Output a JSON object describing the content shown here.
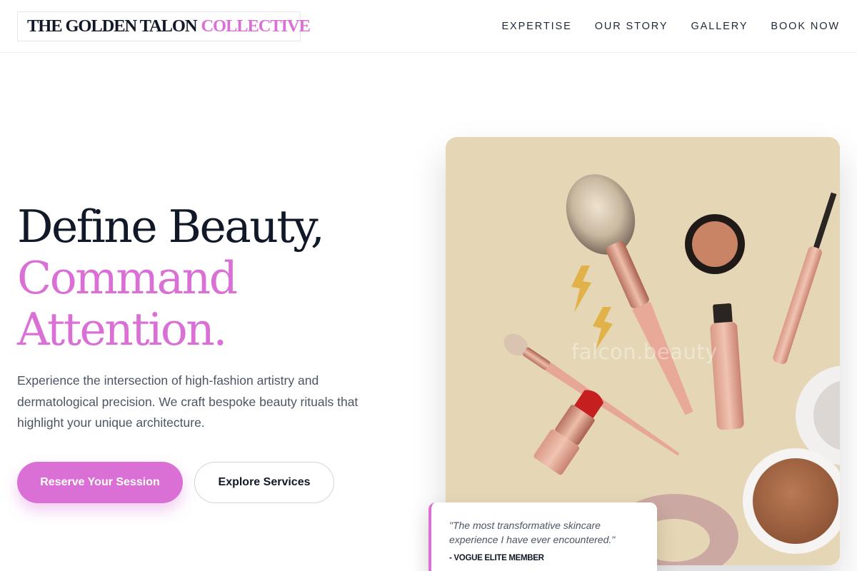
{
  "brand": {
    "name_primary": "THE GOLDEN TALON",
    "name_accent": "COLLECTIVE",
    "accent_color": "#da70d6",
    "dark_color": "#111827"
  },
  "nav": {
    "items": [
      {
        "label": "EXPERTISE"
      },
      {
        "label": "OUR STORY"
      },
      {
        "label": "GALLERY"
      },
      {
        "label": "BOOK NOW"
      }
    ]
  },
  "hero": {
    "headline_line1": "Define Beauty,",
    "headline_line2": "Command",
    "headline_line3": "Attention.",
    "description": "Experience the intersection of high-fashion artistry and dermatological precision. We craft bespoke beauty rituals that highlight your unique architecture.",
    "primary_button": "Reserve Your Session",
    "secondary_button": "Explore Services",
    "image_watermark": "falcon.beauty"
  },
  "testimonial": {
    "quote": "\"The most transformative skincare experience I have ever encountered.\"",
    "author": "- VOGUE ELITE MEMBER"
  }
}
